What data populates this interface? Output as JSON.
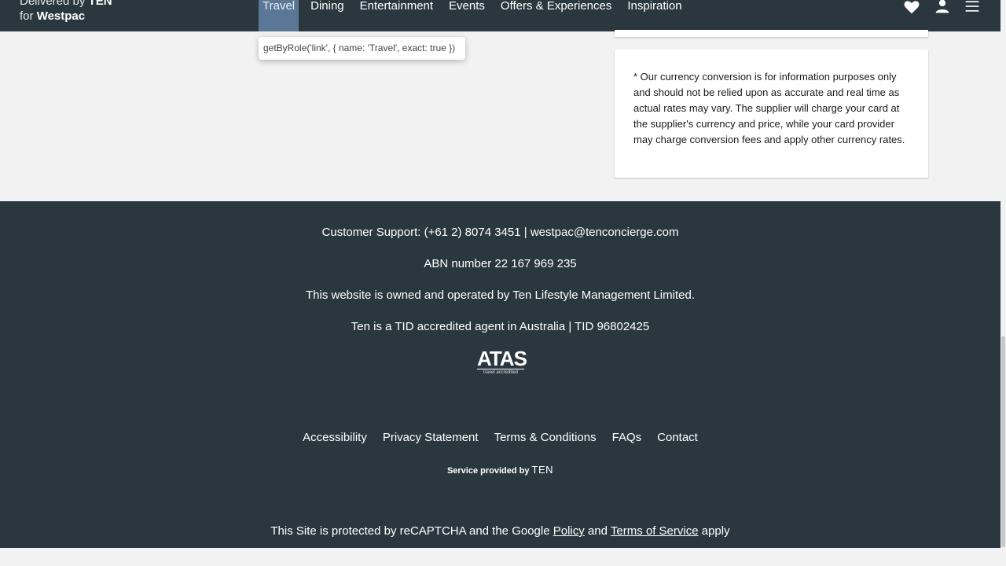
{
  "brand": {
    "line1_prefix": "Delivered by",
    "line1_logo": "TEN",
    "line2_prefix": "for",
    "line2_name": "Westpac"
  },
  "nav": {
    "items": [
      {
        "label": "Travel"
      },
      {
        "label": "Dining"
      },
      {
        "label": "Entertainment"
      },
      {
        "label": "Events"
      },
      {
        "label": "Offers & Experiences"
      },
      {
        "label": "Inspiration"
      }
    ]
  },
  "header_icons": [
    "heart-icon",
    "user-icon",
    "menu-icon"
  ],
  "tooltip": {
    "text": "getByRole('link', { name: 'Travel', exact: true })"
  },
  "disclaimer": {
    "text": "* Our currency conversion is for information purposes only and should not be relied upon as accurate and real time as actual rates may vary. The supplier will charge your card at the supplier's currency and price, while your card provider may charge conversion fees and apply other currency rates."
  },
  "footer": {
    "support": "Customer Support: (+61 2) 8074 3451 | westpac@tenconcierge.com",
    "abn": "ABN number 22 167 969 235",
    "owner": "This website is owned and operated by Ten Lifestyle Management Limited.",
    "tid": "Ten is a TID accredited agent in Australia | TID 96802425",
    "atas_logo": "ATAS",
    "atas_sub": "travel accredited",
    "links": [
      {
        "label": "Accessibility"
      },
      {
        "label": "Privacy Statement"
      },
      {
        "label": "Terms & Conditions"
      },
      {
        "label": "FAQs"
      },
      {
        "label": "Contact"
      }
    ],
    "service_prefix": "Service provided by",
    "service_logo": "TEN",
    "recaptcha_prefix": "This Site is protected by reCAPTCHA and the Google",
    "recaptcha_policy": "Policy",
    "recaptcha_and": "and",
    "recaptcha_terms": "Terms of Service",
    "recaptcha_suffix": "apply"
  }
}
